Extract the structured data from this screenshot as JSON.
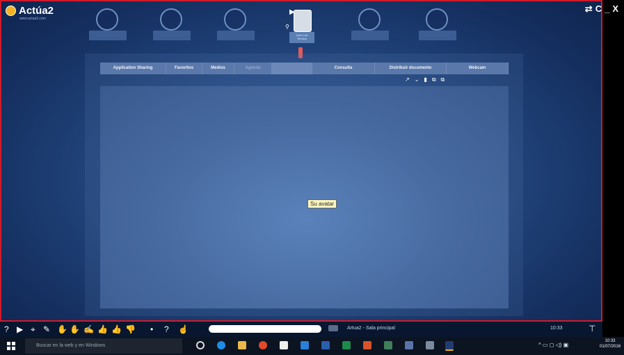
{
  "window": {
    "app_name": "Actúa2",
    "app_tagline": "www.actua2.com",
    "controls": {
      "swap": "⇄",
      "refresh": "C",
      "minimize": "_",
      "close": "X"
    },
    "border_color": "#d21a2a"
  },
  "seats": {
    "user": {
      "name_line1": "Jose Luis",
      "name_line2": "Terroba",
      "flag": "▶"
    }
  },
  "tabs": [
    {
      "label": "Application Sharing",
      "dim": false
    },
    {
      "label": "Favoritos",
      "dim": false
    },
    {
      "label": "Medios",
      "dim": false
    },
    {
      "label": "Agenda",
      "dim": true
    },
    {
      "label": "",
      "dim": false
    },
    {
      "label": "Consulta",
      "dim": false
    },
    {
      "label": "Distribuir documento",
      "dim": false
    },
    {
      "label": "Webcam",
      "dim": false
    }
  ],
  "board_tools": [
    "↗",
    "⌄",
    "▮",
    "⧉",
    "⧉"
  ],
  "board": {
    "avatar_label": "Su avatar"
  },
  "app_toolbar": {
    "icons": [
      "?",
      "▶",
      "⌖",
      "✎",
      "✋",
      "✋",
      "✍",
      "👍",
      "👍",
      "👎",
      "•",
      "?",
      "☝"
    ],
    "chat_label": "Artua2 - Sala principal",
    "clock": "10:33",
    "pin_icon": "⊤"
  },
  "taskbar": {
    "search_placeholder": "Buscar en la web y en Windows",
    "tray_icons": "^ ▭ ◻ ◁) ▣",
    "time": "10:33",
    "date": "01/07/2016"
  }
}
